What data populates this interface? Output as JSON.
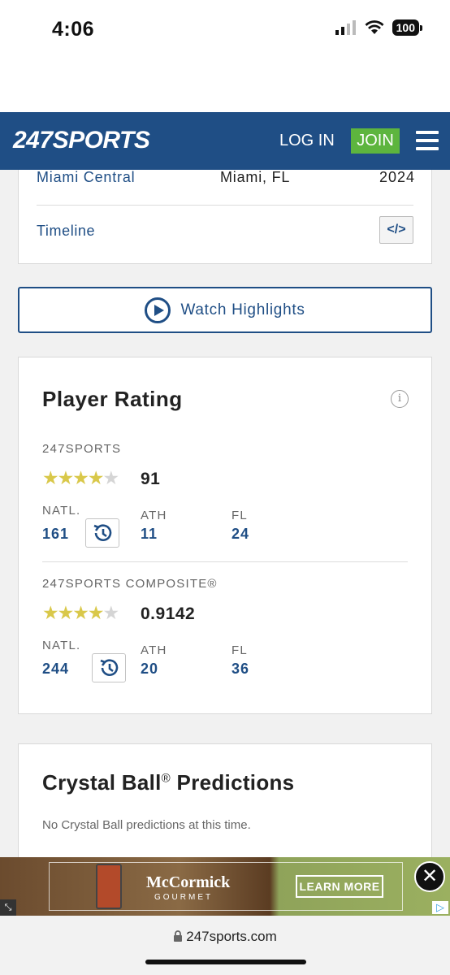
{
  "status_bar": {
    "time": "4:06",
    "battery": "100"
  },
  "nav": {
    "logo_num": "247",
    "logo_text": "SPORTS",
    "login": "LOG IN",
    "join": "JOIN"
  },
  "profile": {
    "school": "Miami Central",
    "city": "Miami, FL",
    "year": "2024",
    "timeline": "Timeline",
    "embed_icon": "</>"
  },
  "highlights": {
    "label": "Watch Highlights"
  },
  "rating": {
    "title": "Player Rating",
    "sections": [
      {
        "label": "247SPORTS",
        "stars": 4,
        "score": "91",
        "ranks": [
          {
            "label": "NATL.",
            "value": "161"
          },
          {
            "label": "ATH",
            "value": "11"
          },
          {
            "label": "FL",
            "value": "24"
          }
        ]
      },
      {
        "label": "247SPORTS COMPOSITE®",
        "stars": 4,
        "score": "0.9142",
        "ranks": [
          {
            "label": "NATL.",
            "value": "244"
          },
          {
            "label": "ATH",
            "value": "20"
          },
          {
            "label": "FL",
            "value": "36"
          }
        ]
      }
    ]
  },
  "crystal_ball": {
    "title": "Crystal Ball",
    "title_suffix": " Predictions",
    "reg": "®",
    "note": "No Crystal Ball predictions at this time."
  },
  "ad": {
    "brand": "McCormick",
    "sub": "GOURMET",
    "cta": "LEARN MORE",
    "close": "✕"
  },
  "browser": {
    "url": "247sports.com"
  }
}
